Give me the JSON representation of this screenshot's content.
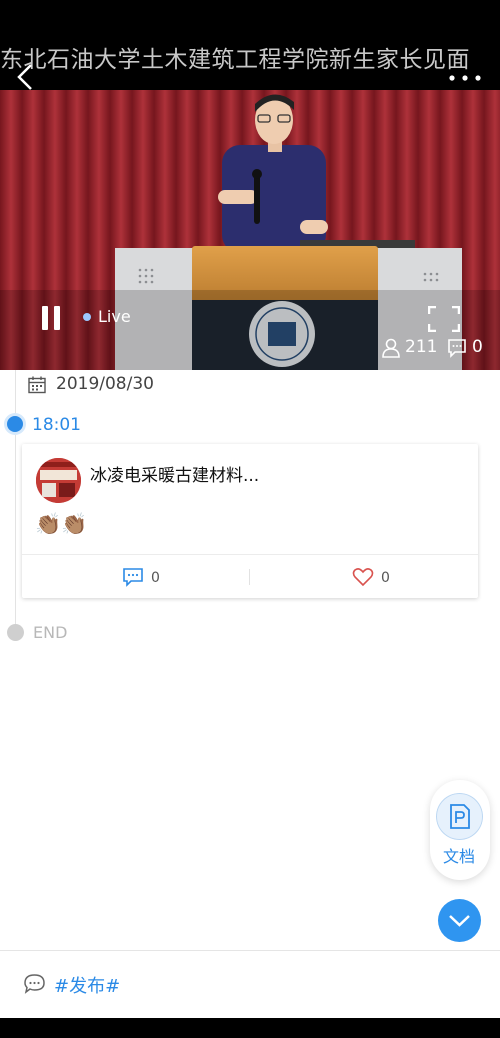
{
  "header": {
    "title": "东北石油大学土木建筑工程学院新生家长见面"
  },
  "player": {
    "live_label": "Live",
    "viewer_count": "211",
    "comment_count": "0"
  },
  "timeline": {
    "date": "2019/08/30",
    "time": "18:01",
    "end_label": "END",
    "post": {
      "username": "冰凌电采暖古建材料...",
      "message": "👏🏽👏🏽",
      "comment_count": "0",
      "like_count": "0"
    }
  },
  "doc_button": {
    "label": "文档"
  },
  "composer": {
    "label": "#发布#"
  },
  "colors": {
    "accent": "#2b8ae6",
    "curtain": "#a3262e"
  }
}
